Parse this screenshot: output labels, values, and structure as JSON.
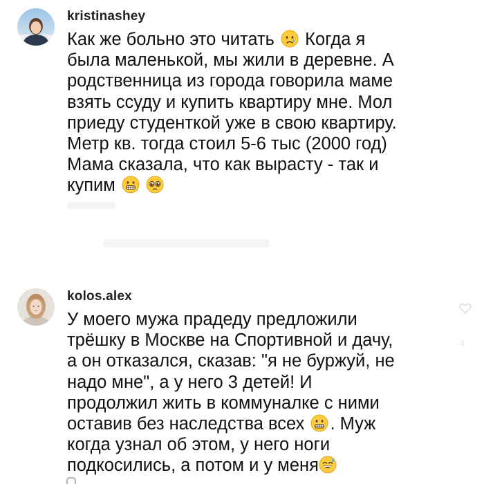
{
  "comments": [
    {
      "username": "kristinashey",
      "lines": [
        "Как же больно это читать",
        "Когда я",
        "была маленькой, мы жили в деревне. А",
        "родственница из города говорила маме",
        "взять ссуду и купить квартиру мне. Мол",
        "приеду студенткой уже в свою квартиру.",
        "Метр кв. тогда стоил 5-6 тыс (2000 год)",
        "Мама сказала, что как вырасту - так и",
        "купим"
      ],
      "emoji_names": [
        "crying-face-emoji",
        "grimacing-face-emoji",
        "pleading-face-emoji"
      ]
    },
    {
      "username": "kolos.alex",
      "lines": [
        "У моего мужа прадеду предложили",
        "трёшку в Москве на Спортивной и дачу,",
        "а он отказался, сказав: \"я не буржуй, не",
        "надо мне\", а у него 3 детей! И",
        "продолжил жить в коммуналке с ними",
        "оставив без наследства всех",
        ". Муж",
        "когда узнал об этом, у него ноги",
        "подкосились, а потом и у меня"
      ],
      "emoji_names": [
        "grimacing-face-emoji",
        "grinning-sweat-emoji"
      ]
    }
  ]
}
